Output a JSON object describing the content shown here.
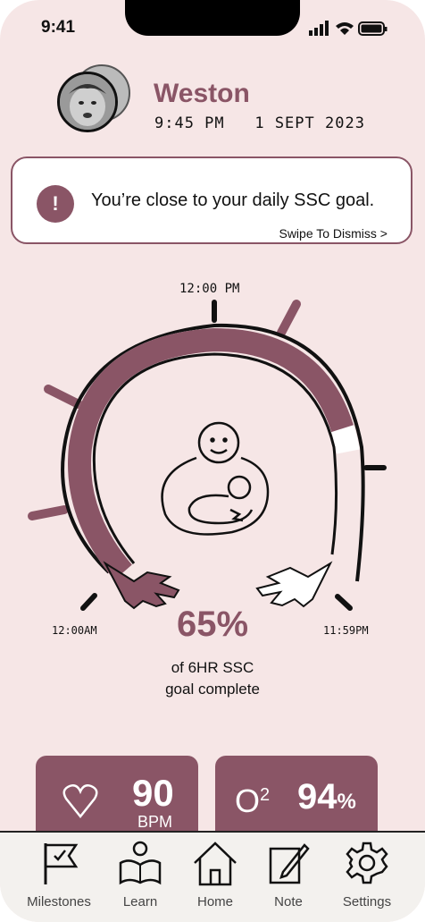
{
  "status_bar": {
    "time": "9:41"
  },
  "profile": {
    "name": "Weston",
    "time": "9:45 PM",
    "date": "1 SEPT 2023",
    "datetime_display": "9:45 PM   1 SEPT 2023"
  },
  "alert": {
    "icon": "!",
    "message": "You’re close to your daily SSC goal.",
    "dismiss": "Swipe To Dismiss >"
  },
  "gauge": {
    "top_label": "12:00 PM",
    "left_label": "12:00AM",
    "right_label": "11:59PM",
    "progress_fraction": 0.65,
    "percent": "65%",
    "caption_line1": "of 6HR SSC",
    "caption_line2": "goal complete"
  },
  "cards": {
    "heart": {
      "icon": "heart-icon",
      "value": "90",
      "unit": "BPM"
    },
    "oxygen": {
      "label": "O",
      "sup": "2",
      "value": "94",
      "unit": "%"
    }
  },
  "tabs": [
    {
      "label": "Milestones",
      "icon": "flag-icon"
    },
    {
      "label": "Learn",
      "icon": "reader-icon"
    },
    {
      "label": "Home",
      "icon": "home-icon"
    },
    {
      "label": "Note",
      "icon": "note-icon"
    },
    {
      "label": "Settings",
      "icon": "gear-icon"
    }
  ],
  "colors": {
    "accent": "#8a5566",
    "background": "#f6e6e6",
    "tabbar": "#f3f1ee"
  }
}
